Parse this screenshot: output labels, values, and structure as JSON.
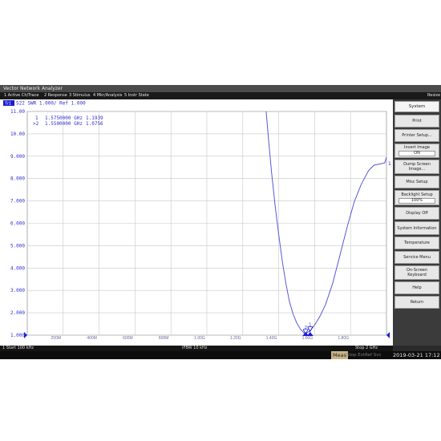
{
  "app": {
    "title": "Vector Network Analyzer"
  },
  "menu": [
    {
      "label": "1 Active Ch/Trace"
    },
    {
      "label": "2 Response"
    },
    {
      "label": "3 Stimulus"
    },
    {
      "label": "4 Mkr/Analysis"
    },
    {
      "label": "5 Instr State"
    }
  ],
  "menu_right": "Resize",
  "trace_header": {
    "badge": "Tr1",
    "text": "S22  SWR 1.000/ Ref 1.000"
  },
  "markers": [
    {
      "label": "1",
      "freq": "1.5750000 GHz",
      "value": "1.1939"
    },
    {
      "label": ">2",
      "freq": "1.5500000 GHz",
      "value": "1.0756"
    }
  ],
  "trace_end_label": "1",
  "status": {
    "start": "1  Start 100 kHz",
    "ifbw": "IFBW 10 kHz",
    "stop": "Stop 2 GHz"
  },
  "softkeys": {
    "header": "System",
    "items": [
      {
        "label": "Print"
      },
      {
        "label": "Printer Setup..."
      },
      {
        "label": "Invert Image",
        "value": "ON"
      },
      {
        "label": "Dump Screen Image..."
      },
      {
        "label": "Misc Setup"
      },
      {
        "label": "Backlight Setup",
        "value": "100%"
      },
      {
        "label": "Display Off"
      },
      {
        "label": "System Information"
      },
      {
        "label": "Temperature"
      },
      {
        "label": "Service Menu"
      },
      {
        "label": "On-Screen Keyboard"
      },
      {
        "label": "Help"
      },
      {
        "label": "Return"
      }
    ]
  },
  "bottom": {
    "meas": "Meas",
    "hold": "Stop ExtRef Svc",
    "datetime": "2019-03-21 17:12"
  },
  "colors": {
    "trace": "#5858d8",
    "grid": "#c8c8c8",
    "header_text": "#2f2fd0",
    "badge": "#1d1dcf"
  },
  "chart_data": {
    "type": "line",
    "title": "S22  SWR 1.000/ Ref 1.000",
    "xlabel": "",
    "ylabel": "",
    "xlim": [
      0.0001,
      2.0
    ],
    "ylim": [
      1.0,
      11.0
    ],
    "y_ticks": [
      "1.000",
      "2.000",
      "3.000",
      "4.000",
      "5.000",
      "6.000",
      "7.000",
      "8.000",
      "9.000",
      "10.00",
      "11.00"
    ],
    "x_ticks": [
      {
        "x": 0.2,
        "label": "200M"
      },
      {
        "x": 0.4,
        "label": "400M"
      },
      {
        "x": 0.6,
        "label": "600M"
      },
      {
        "x": 0.8,
        "label": "800M"
      },
      {
        "x": 1.0,
        "label": "1.00G"
      },
      {
        "x": 1.2,
        "label": "1.20G"
      },
      {
        "x": 1.4,
        "label": "1.40G"
      },
      {
        "x": 1.6,
        "label": "1.60G"
      },
      {
        "x": 1.8,
        "label": "1.80G"
      }
    ],
    "series": [
      {
        "x": [
          1.33,
          1.345,
          1.36,
          1.38,
          1.4,
          1.42,
          1.44,
          1.46,
          1.48,
          1.5,
          1.52,
          1.54,
          1.55,
          1.56,
          1.575,
          1.6,
          1.63,
          1.66,
          1.7,
          1.74,
          1.78,
          1.82,
          1.86,
          1.9,
          1.93,
          1.96,
          1.99,
          2.0
        ],
        "y": [
          11.0,
          9.6,
          8.3,
          6.8,
          5.5,
          4.3,
          3.3,
          2.5,
          1.95,
          1.55,
          1.28,
          1.1,
          1.0756,
          1.12,
          1.1939,
          1.45,
          1.85,
          2.35,
          3.3,
          4.55,
          5.8,
          6.95,
          7.75,
          8.35,
          8.6,
          8.65,
          8.7,
          8.95
        ]
      }
    ],
    "markers": [
      {
        "id": "1",
        "x": 1.575,
        "y": 1.1939
      },
      {
        "id": "2",
        "x": 1.55,
        "y": 1.0756
      }
    ],
    "grid": true
  }
}
